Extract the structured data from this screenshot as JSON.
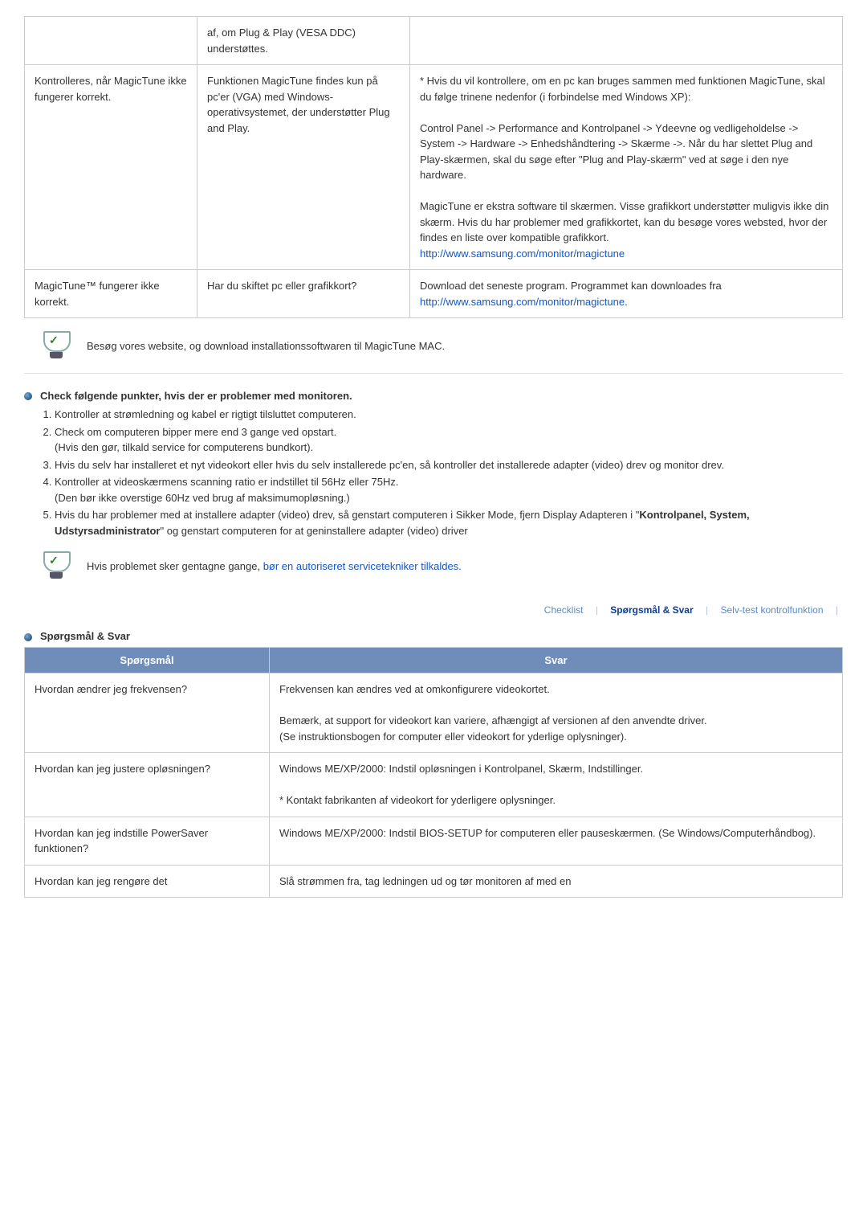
{
  "table1": {
    "row0": {
      "c2": "af, om Plug & Play (VESA DDC) understøttes."
    },
    "row1": {
      "c1": "Kontrolleres, når MagicTune ikke fungerer korrekt.",
      "c2": "Funktionen MagicTune findes kun på pc'er (VGA) med Windows-operativsystemet, der understøtter Plug and Play.",
      "c3a": "* Hvis du vil kontrollere, om en pc kan bruges sammen med funktionen MagicTune, skal du følge trinene nedenfor (i forbindelse med Windows XP):",
      "c3b": "Control Panel -> Performance and Kontrolpanel -> Ydeevne og vedligeholdelse -> System -> Hardware -> Enhedshåndtering -> Skærme ->. Når du har slettet Plug and Play-skærmen, skal du søge efter \"Plug and Play-skærm\" ved at søge i den nye hardware.",
      "c3c": "MagicTune er ekstra software til skærmen. Visse grafikkort understøtter muligvis ikke din skærm. Hvis du har problemer med grafikkortet, kan du besøge vores websted, hvor der findes en liste over kompatible grafikkort.",
      "c3link": "http://www.samsung.com/monitor/magictune"
    },
    "row2": {
      "c1": "MagicTune™ fungerer ikke korrekt.",
      "c2": "Har du skiftet pc eller grafikkort?",
      "c3a": "Download det seneste program. Programmet kan downloades fra",
      "c3link": "http://www.samsung.com/monitor/magictune"
    }
  },
  "note1": "Besøg vores website, og download installationssoftwaren til MagicTune MAC.",
  "check_heading": "Check følgende punkter, hvis der er problemer med monitoren.",
  "checklist": {
    "i1": "Kontroller at strømledning og kabel er rigtigt tilsluttet computeren.",
    "i2": "Check om computeren bipper mere end 3 gange ved opstart.\n(Hvis den gør, tilkald service for computerens bundkort).",
    "i3": "Hvis du selv har installeret et nyt videokort eller hvis du selv installerede pc'en, så kontroller det installerede adapter (video) drev og monitor drev.",
    "i4": "Kontroller at videoskærmens scanning ratio er indstillet til 56Hz eller 75Hz.\n(Den bør ikke overstige 60Hz ved brug af maksimumopløsning.)",
    "i5a": "Hvis du har problemer med at installere adapter (video) drev, så genstart computeren i Sikker Mode, fjern Display Adapteren i \"",
    "i5b": "Kontrolpanel, System, Udstyrsadministrator",
    "i5c": "\" og genstart computeren for at geninstallere adapter (video) driver"
  },
  "note2a": "Hvis problemet sker gentagne gange, ",
  "note2b": "bør en autoriseret servicetekniker tilkaldes.",
  "tabs": {
    "checklist": "Checklist",
    "qa": "Spørgsmål & Svar",
    "selftest": "Selv-test kontrolfunktion"
  },
  "qa_heading": "Spørgsmål & Svar",
  "qa_table": {
    "h1": "Spørgsmål",
    "h2": "Svar",
    "r1q": "Hvordan ændrer jeg frekvensen?",
    "r1a": "Frekvensen kan ændres ved at omkonfigurere videokortet.",
    "r1b": "Bemærk, at support for videokort kan variere, afhængigt af versionen af den anvendte driver.\n(Se instruktionsbogen for computer eller videokort for yderlige oplysninger).",
    "r2q": "Hvordan kan jeg justere opløsningen?",
    "r2a": "Windows ME/XP/2000: Indstil opløsningen i Kontrolpanel, Skærm, Indstillinger.",
    "r2b": "* Kontakt fabrikanten af videokort for yderligere oplysninger.",
    "r3q": "Hvordan kan jeg indstille PowerSaver funktionen?",
    "r3a": "Windows ME/XP/2000: Indstil BIOS-SETUP for computeren eller pauseskærmen. (Se Windows/Computerhåndbog).",
    "r4q": "Hvordan kan jeg rengøre det",
    "r4a": "Slå strømmen fra, tag ledningen ud og tør monitoren af med en"
  }
}
